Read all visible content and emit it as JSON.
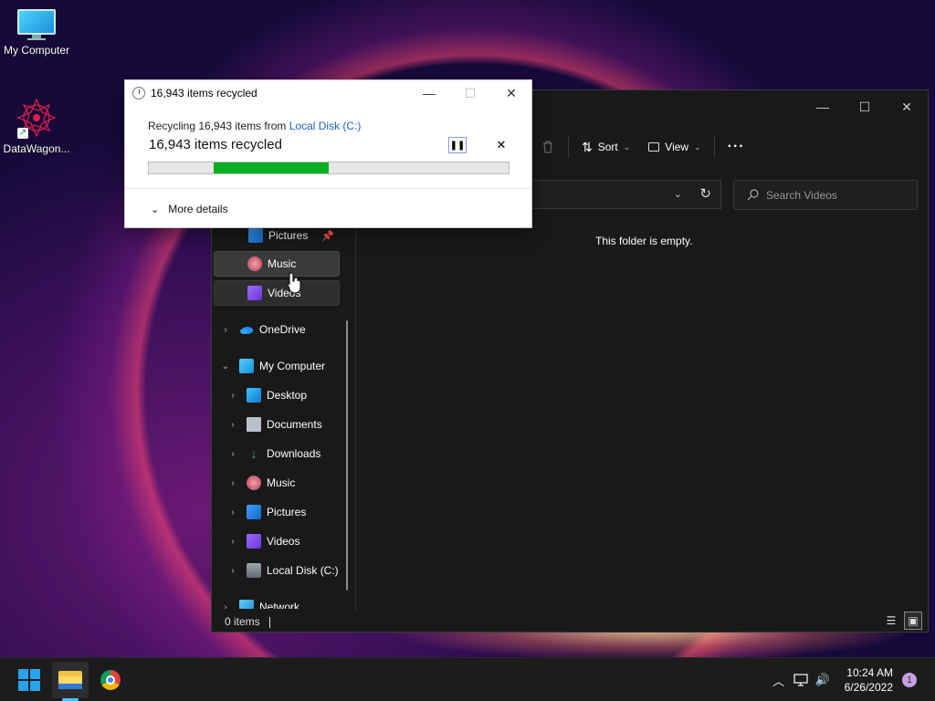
{
  "desktop": {
    "icons": [
      {
        "label": "My Computer"
      },
      {
        "label": "DataWagon..."
      }
    ]
  },
  "explorer": {
    "toolbar": {
      "sort_label": "Sort",
      "view_label": "View"
    },
    "search": {
      "placeholder": "Search Videos"
    },
    "empty_message": "This folder is empty.",
    "status": {
      "items": "0 items"
    },
    "nav": {
      "pictures": "Pictures",
      "music": "Music",
      "videos": "Videos",
      "onedrive": "OneDrive",
      "my_computer": "My Computer",
      "desktop": "Desktop",
      "documents": "Documents",
      "downloads": "Downloads",
      "music2": "Music",
      "pictures2": "Pictures",
      "videos2": "Videos",
      "local_disk": "Local Disk (C:)",
      "network": "Network"
    }
  },
  "dialog": {
    "title": "16,943 items recycled",
    "sub_prefix": "Recycling 16,943 items from ",
    "sub_link": "Local Disk (C:)",
    "heading": "16,943 items recycled",
    "progress": {
      "start": 0.18,
      "end": 0.5
    },
    "details_label": "More details"
  },
  "taskbar": {
    "time": "10:24 AM",
    "date": "6/26/2022",
    "notification_count": "1"
  },
  "colors": {
    "progress_fill": "#06b025",
    "accent": "#4cc2ff",
    "link": "#1a64c8"
  }
}
